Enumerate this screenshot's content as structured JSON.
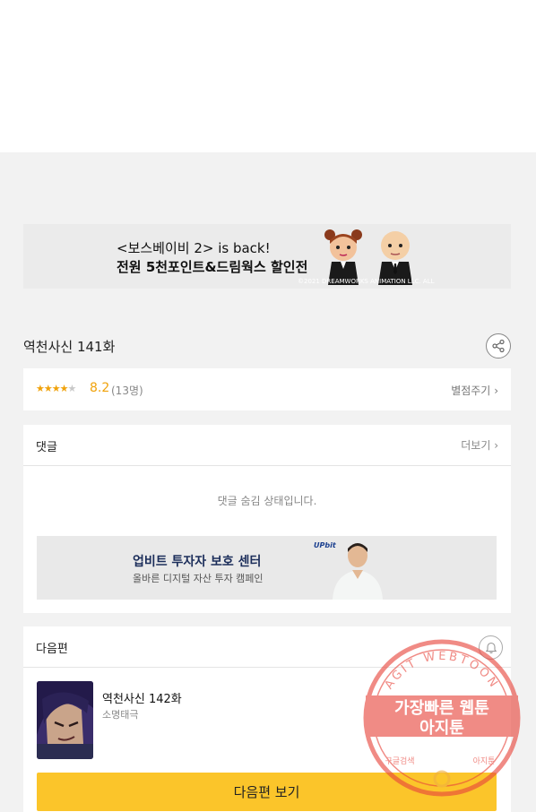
{
  "ad_banner_top": {
    "line1": "<보스베이비 2> is back!",
    "line2": "전원 5천포인트&드림웍스 할인전",
    "copyright": "©2021 DREAMWORKS ANIMATION LLC. ALL"
  },
  "episode": {
    "title": "역천사신 141화"
  },
  "rating": {
    "filled_stars": 4,
    "total_stars": 5,
    "value": "8.2",
    "count": "(13명)",
    "rate_link": "별점주기"
  },
  "comments": {
    "heading": "댓글",
    "more_link": "더보기",
    "hidden_message": "댓글 숨김 상태입니다.",
    "ad": {
      "title": "업비트 투자자 보호 센터",
      "subtitle": "올바른 디지털 자산 투자 캠페인",
      "logo": "UPbit"
    }
  },
  "next_episode": {
    "heading": "다음편",
    "title": "역천사신 142화",
    "author": "소명태극",
    "button_label": "다음편 보기"
  },
  "watermark": {
    "arc_text": "AGIT WEBTOON",
    "line1": "가장빠른 웹툰",
    "line2": "아지툰",
    "bottom_left": "구글검색",
    "bottom_right": "아지툰"
  },
  "colors": {
    "accent_yellow": "#fbc52a",
    "star_orange": "#f0a20b",
    "watermark_red": "#e8453c"
  }
}
